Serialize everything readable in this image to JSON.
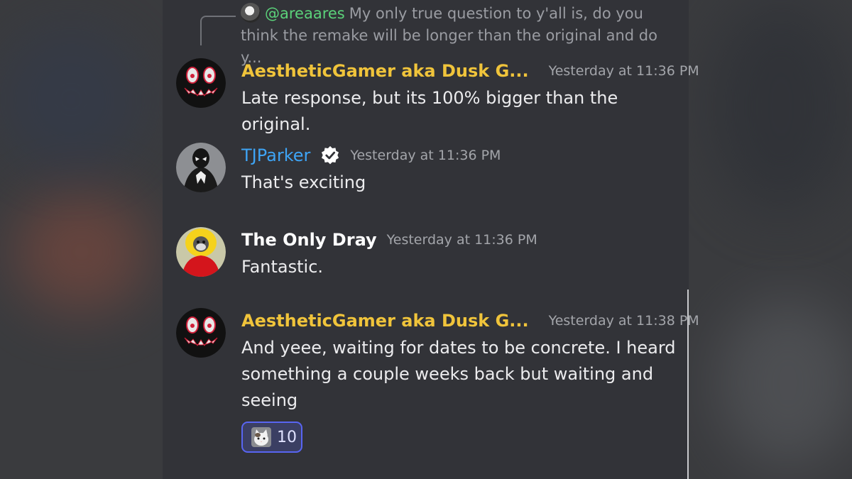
{
  "reply": {
    "mention": "@areaares",
    "line1": "My only true question to y'all is, do you",
    "line2": "think the remake will be longer than the original and do y..."
  },
  "messages": [
    {
      "username": "AestheticGamer aka Dusk G...",
      "username_color": "#f0c43b",
      "badge": "gold-verified-badge",
      "timestamp": "Yesterday at 11:36 PM",
      "body": [
        "Late response, but its 100% bigger than the original."
      ]
    },
    {
      "username": "TJParker",
      "username_color": "#3ea4f5",
      "badge": "white-verified-badge",
      "timestamp": "Yesterday at 11:36 PM",
      "body": [
        "That's exciting"
      ]
    },
    {
      "username": "The Only Dray",
      "username_color": "#ffffff",
      "timestamp": "Yesterday at 11:36 PM",
      "body": [
        "Fantastic."
      ]
    },
    {
      "username": "AestheticGamer aka Dusk G...",
      "username_color": "#f0c43b",
      "badge": "gold-verified-badge",
      "timestamp": "Yesterday at 11:38 PM",
      "body": [
        "And yeee, waiting for dates to be concrete. I heard",
        "something a couple weeks back but waiting and",
        "seeing"
      ],
      "reaction": {
        "emoji": "cat-emoji",
        "count": "10"
      }
    }
  ]
}
